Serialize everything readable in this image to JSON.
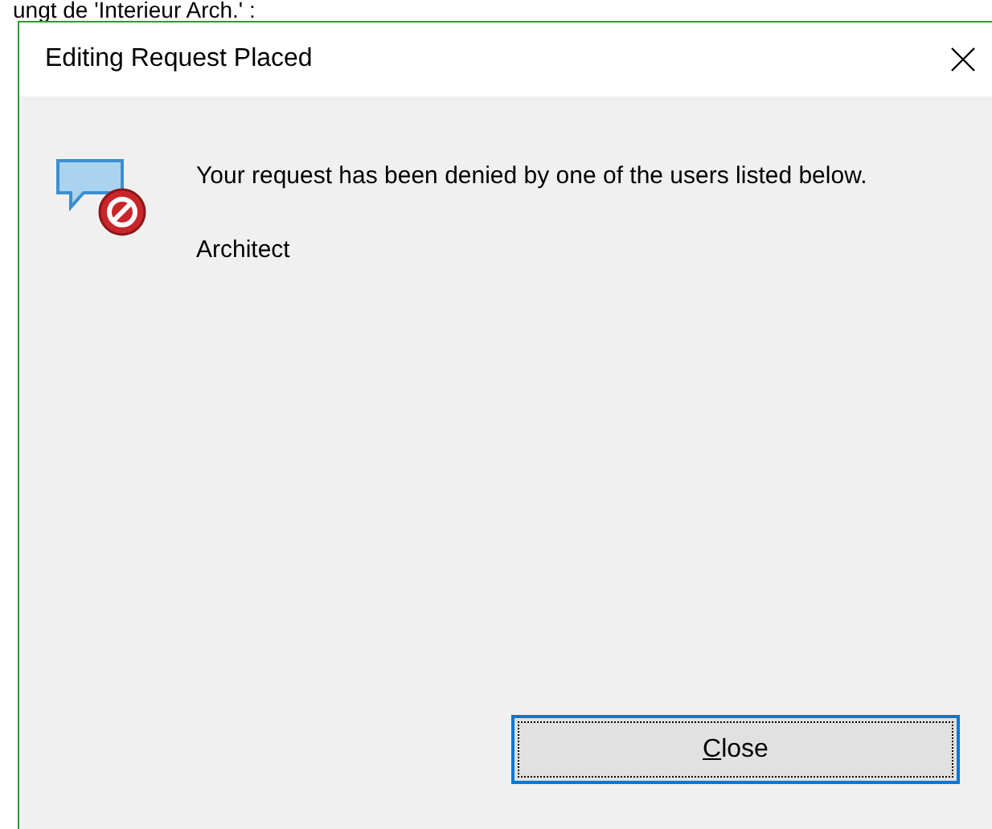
{
  "background_text": "ungt de 'Interieur Arch.' :",
  "dialog": {
    "title": "Editing Request Placed",
    "message": "Your request has been denied by one of the users listed below.",
    "users": [
      "Architect"
    ],
    "button": {
      "label": "Close",
      "underline_first": true,
      "focused": true
    }
  }
}
